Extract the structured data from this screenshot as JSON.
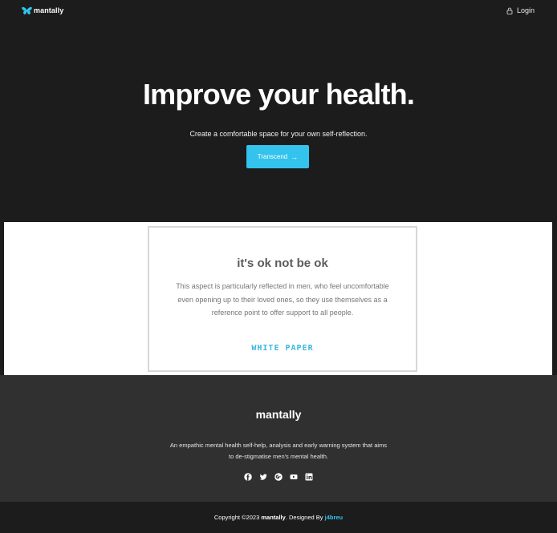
{
  "nav": {
    "brand": "mantally",
    "login_label": "Login"
  },
  "hero": {
    "title": "Improve your health.",
    "subtitle": "Create a comfortable space for your own self-reflection.",
    "cta_label": "Transcend",
    "cta_arrow": "→"
  },
  "card": {
    "title": "it's ok not be ok",
    "body": "This aspect is particularly reflected in men, who feel uncomfortable even opening up to their loved ones, so they use themselves as a reference point to offer support to all people.",
    "link_label": "WHITE PAPER"
  },
  "footer": {
    "title": "mantally",
    "description": "An empathic mental health self-help, analysis and early warning system that aims to de-stigmatise men's mental health.",
    "socials": [
      "facebook-icon",
      "twitter-icon",
      "google-plus-icon",
      "youtube-icon",
      "linkedin-icon"
    ]
  },
  "copyright": {
    "prefix": "Copyright ©2023",
    "brand": "mantally",
    "designed_by": ". Designed By",
    "author": "j4breu"
  },
  "colors": {
    "accent": "#33c3ec",
    "background": "#1c1c1c",
    "footer": "#303030"
  }
}
